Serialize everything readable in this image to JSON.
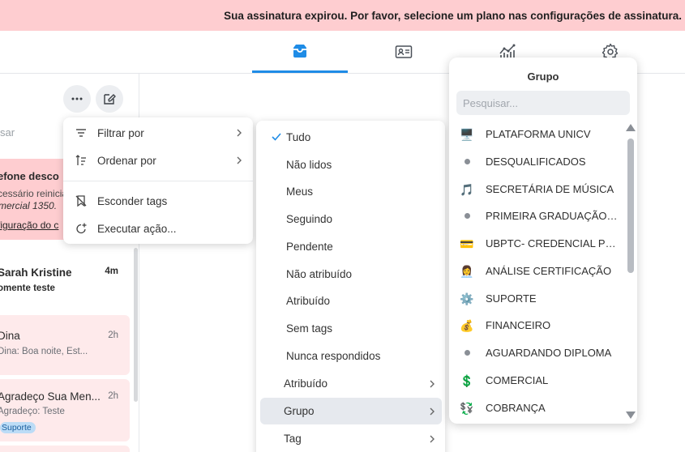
{
  "banner": {
    "text": "Sua assinatura expirou. Por favor, selecione um plano nas configurações de assinatura."
  },
  "topbar": {
    "tabs": [
      {
        "icon": "inbox-icon",
        "active": true
      },
      {
        "icon": "contact-card-icon",
        "active": false
      },
      {
        "icon": "reports-chart-icon",
        "active": false
      },
      {
        "icon": "gear-icon",
        "active": false
      }
    ],
    "accent": "#1f8ce6"
  },
  "leftpanel": {
    "search_fragment": "sar",
    "alert": {
      "title": "efone desco",
      "line1": "cessário reinicia",
      "line2": "mercial 1350.",
      "link": "figuração do c"
    },
    "conversations": [
      {
        "name": "Sarah Kristine",
        "time": "4m",
        "preview": "omente teste"
      },
      {
        "name": "Dina",
        "time": "2h",
        "preview": "Dina: Boa noite, Est..."
      },
      {
        "name": "Agradeço Sua Men...",
        "time": "2h",
        "preview": "Agradeço: Teste",
        "badge": "Suporte"
      }
    ]
  },
  "menu_actions": {
    "items": [
      {
        "icon": "filter-icon",
        "label": "Filtrar por",
        "has_submenu": true
      },
      {
        "icon": "sort-icon",
        "label": "Ordenar por",
        "has_submenu": true
      },
      {
        "icon": "hide-tag-icon",
        "label": "Esconder tags",
        "has_submenu": false
      },
      {
        "icon": "run-action-icon",
        "label": "Executar ação...",
        "has_submenu": false
      }
    ]
  },
  "menu_filter": {
    "items": [
      {
        "label": "Tudo",
        "checked": true
      },
      {
        "label": "Não lidos"
      },
      {
        "label": "Meus"
      },
      {
        "label": "Seguindo"
      },
      {
        "label": "Pendente"
      },
      {
        "label": "Não atribuído"
      },
      {
        "label": "Atribuído"
      },
      {
        "label": "Sem tags"
      },
      {
        "label": "Nunca respondidos"
      },
      {
        "label": "Atribuído",
        "has_submenu": true
      },
      {
        "label": "Grupo",
        "has_submenu": true,
        "selected": true
      },
      {
        "label": "Tag",
        "has_submenu": true
      }
    ]
  },
  "menu_group": {
    "title": "Grupo",
    "search_placeholder": "Pesquisar...",
    "items": [
      {
        "icon": "computer-icon",
        "glyph": "🖥️",
        "label": "PLATAFORMA UNICV"
      },
      {
        "icon": "dot-icon",
        "glyph": "",
        "label": "DESQUALIFICADOS"
      },
      {
        "icon": "music-note-icon",
        "glyph": "🎵",
        "label": "SECRETÁRIA DE MÚSICA"
      },
      {
        "icon": "dot-icon",
        "glyph": "",
        "label": "PRIMEIRA GRADUAÇÃO U..."
      },
      {
        "icon": "credit-card-icon",
        "glyph": "💳",
        "label": "UBPTC- CREDENCIAL PSIC..."
      },
      {
        "icon": "person-icon",
        "glyph": "👩‍💼",
        "label": "ANÁLISE CERTIFICAÇÃO"
      },
      {
        "icon": "gear-icon",
        "glyph": "⚙️",
        "label": "SUPORTE"
      },
      {
        "icon": "money-bag-icon",
        "glyph": "💰",
        "label": "FINANCEIRO"
      },
      {
        "icon": "dot-icon",
        "glyph": "",
        "label": "AGUARDANDO DIPLOMA"
      },
      {
        "icon": "dollar-icon",
        "glyph": "💲",
        "label": "COMERCIAL"
      },
      {
        "icon": "exchange-icon",
        "glyph": "💱",
        "label": "COBRANÇA"
      }
    ]
  }
}
